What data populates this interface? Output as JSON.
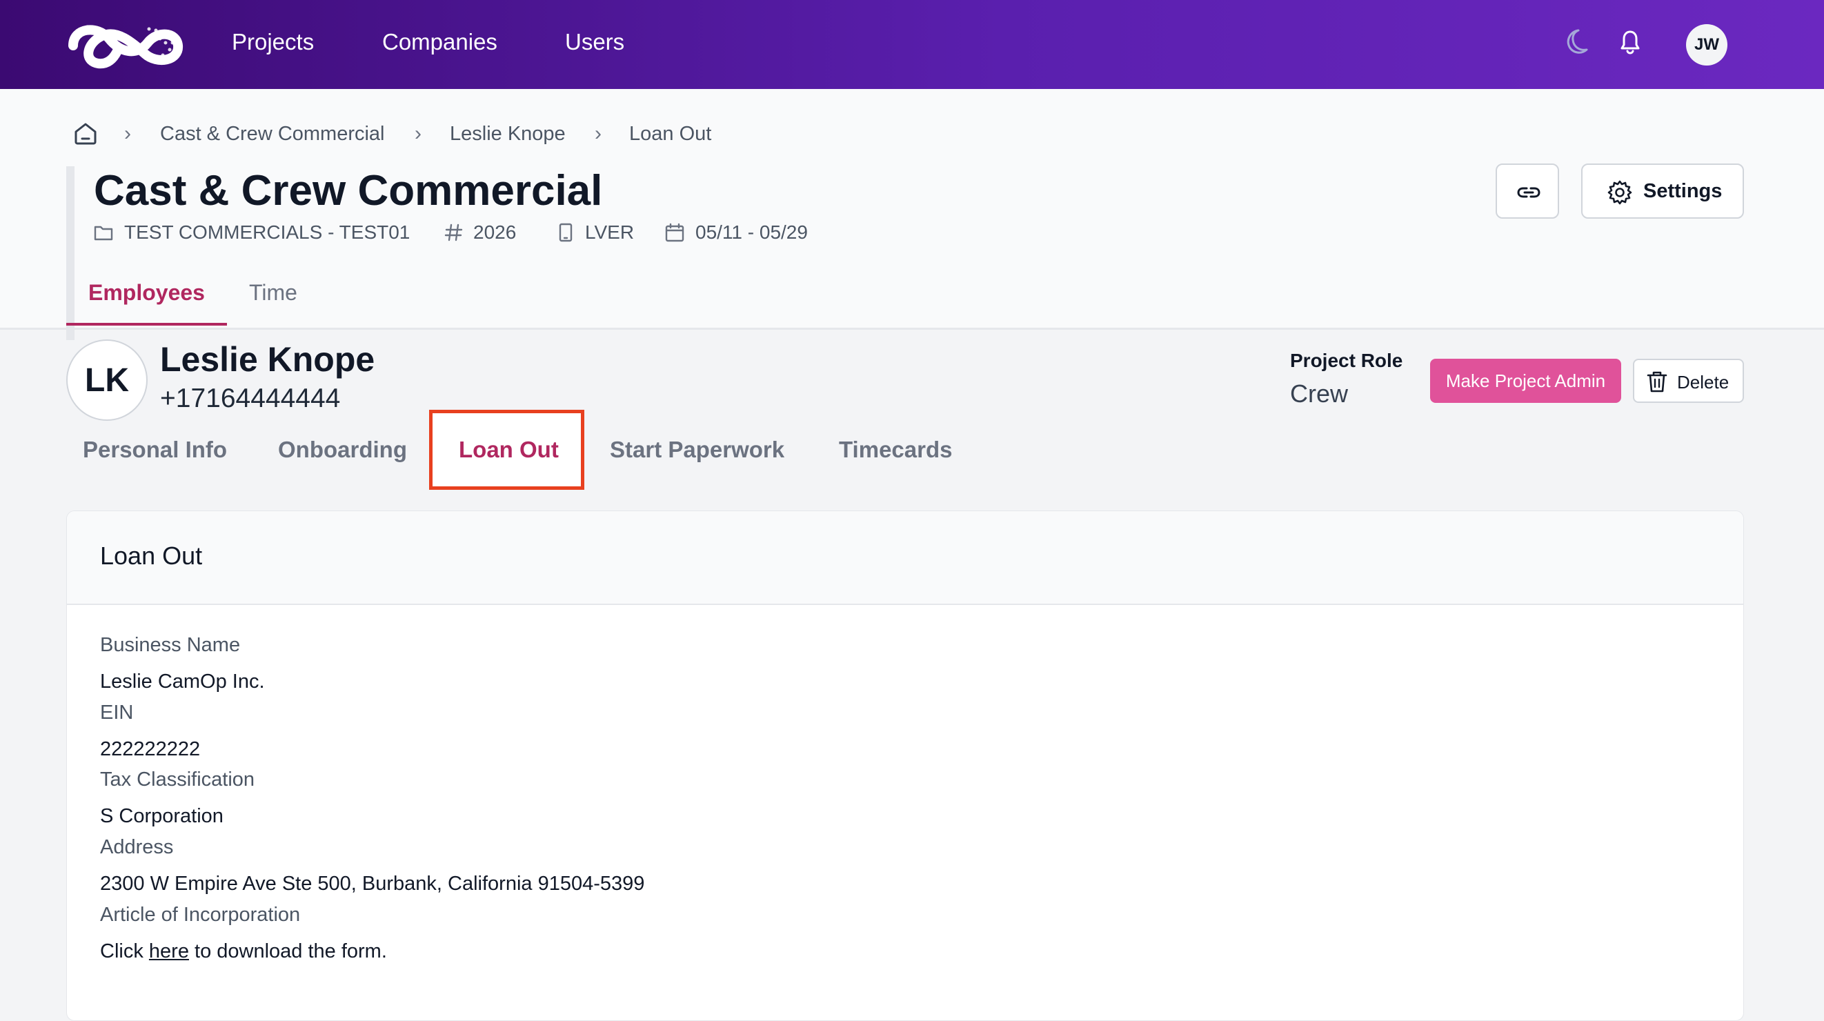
{
  "nav": {
    "items": [
      "Projects",
      "Companies",
      "Users"
    ],
    "user_initials": "JW"
  },
  "breadcrumb": [
    "Cast & Crew Commercial",
    "Leslie Knope",
    "Loan Out"
  ],
  "project": {
    "title": "Cast & Crew Commercial",
    "folder": "TEST COMMERCIALS - TEST01",
    "number": "2026",
    "device": "LVER",
    "dates": "05/11 - 05/29"
  },
  "header_buttons": {
    "settings": "Settings"
  },
  "tabs": [
    "Employees",
    "Time"
  ],
  "employee": {
    "initials": "LK",
    "name": "Leslie Knope",
    "phone": "+17164444444",
    "role_label": "Project Role",
    "role": "Crew",
    "make_admin": "Make Project Admin",
    "delete": "Delete"
  },
  "subtabs": [
    "Personal Info",
    "Onboarding",
    "Loan Out",
    "Start Paperwork",
    "Timecards"
  ],
  "loan_out": {
    "card_title": "Loan Out",
    "fields": [
      {
        "label": "Business Name",
        "value": "Leslie CamOp Inc."
      },
      {
        "label": "EIN",
        "value": "222222222"
      },
      {
        "label": "Tax Classification",
        "value": "S Corporation"
      },
      {
        "label": "Address",
        "value": "2300 W Empire Ave Ste 500, Burbank, California 91504-5399"
      }
    ],
    "article_label": "Article of Incorporation",
    "download_prefix": "Click",
    "download_link": "here",
    "download_suffix": "to download the form."
  },
  "colors": {
    "nav_gradient_start": "#3b0a72",
    "nav_gradient_end": "#6b28c0",
    "accent": "#b0275f",
    "admin_button": "#e0529a",
    "highlight_box": "#e8401f"
  }
}
